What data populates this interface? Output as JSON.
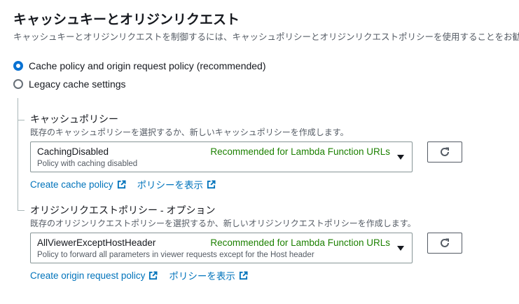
{
  "section": {
    "title": "キャッシュキーとオリジンリクエスト",
    "description": "キャッシュキーとオリジンリクエストを制御するには、キャッシュポリシーとオリジンリクエストポリシーを使用することをお勧めします。"
  },
  "radio_options": [
    {
      "label": "Cache policy and origin request policy (recommended)",
      "selected": true
    },
    {
      "label": "Legacy cache settings",
      "selected": false
    }
  ],
  "cache_policy": {
    "label": "キャッシュポリシー",
    "description": "既存のキャッシュポリシーを選択するか、新しいキャッシュポリシーを作成します。",
    "selected_value": "CachingDisabled",
    "selected_description": "Policy with caching disabled",
    "selected_tag": "Recommended for Lambda Function URLs",
    "create_link": "Create cache policy",
    "view_link": "ポリシーを表示"
  },
  "origin_request_policy": {
    "label": "オリジンリクエストポリシー - オプション",
    "description": "既存のオリジンリクエストポリシーを選択するか、新しいオリジンリクエストポリシーを作成します。",
    "selected_value": "AllViewerExceptHostHeader",
    "selected_description": "Policy to forward all parameters in viewer requests except for the Host header",
    "selected_tag": "Recommended for Lambda Function URLs",
    "create_link": "Create origin request policy",
    "view_link": "ポリシーを表示"
  },
  "colors": {
    "accent": "#0972d3",
    "link": "#0073bb",
    "recommended_tag": "#1d8102",
    "text": "#16191f",
    "secondary_text": "#545b64"
  },
  "icons": {
    "refresh": "refresh-icon",
    "external": "external-link-icon",
    "dropdown": "caret-down-icon"
  }
}
